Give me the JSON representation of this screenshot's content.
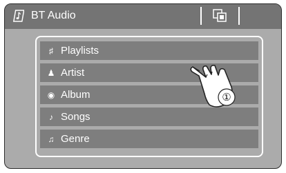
{
  "header": {
    "title": "BT Audio",
    "source_icon": "music-note-icon",
    "copy_icon": "copy-icon"
  },
  "list": {
    "items": [
      {
        "label": "Playlists",
        "icon": "playlist-icon"
      },
      {
        "label": "Artist",
        "icon": "artist-icon"
      },
      {
        "label": "Album",
        "icon": "album-icon"
      },
      {
        "label": "Songs",
        "icon": "note-icon"
      },
      {
        "label": "Genre",
        "icon": "guitar-icon"
      }
    ]
  },
  "callout": {
    "number": "①",
    "icon": "pointing-hand-icon"
  },
  "colors": {
    "screen_bg": "#ababab",
    "header_bg": "#747474",
    "item_bg": "#7e7e7e",
    "text": "#ffffff"
  }
}
